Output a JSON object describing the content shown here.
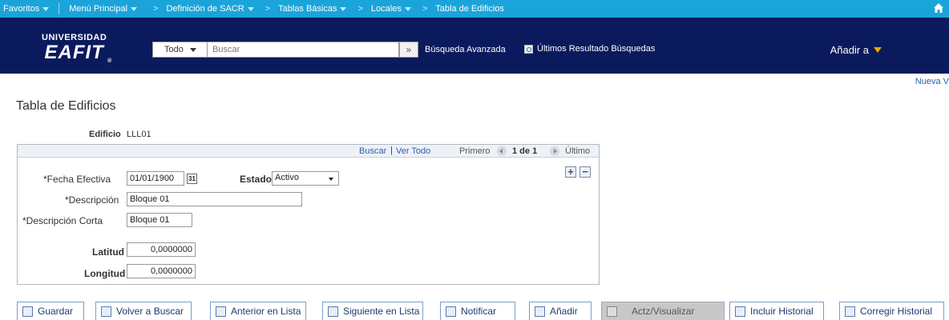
{
  "topnav": {
    "favorites": "Favoritos",
    "main_menu": "Menú Principal",
    "crumbs": [
      "Definición de SACR",
      "Tablas Básicas",
      "Locales",
      "Tabla de Edificios"
    ]
  },
  "header": {
    "logo_line1": "UNIVERSIDAD",
    "logo_line2": "EAFIT",
    "logo_reg": "®",
    "search_scope": "Todo",
    "search_placeholder": "Buscar",
    "search_go": "»",
    "advanced_search": "Búsqueda Avanzada",
    "recent_searches": "Últimos Resultado Búsquedas",
    "add_to": "Añadir a"
  },
  "new_window": "Nueva V",
  "page_title": "Tabla de Edificios",
  "key": {
    "label": "Edificio",
    "value": "LLL01"
  },
  "scroll_head": {
    "search": "Buscar",
    "view_all": "Ver Todo",
    "first": "Primero",
    "position": "1 de 1",
    "last": "Último"
  },
  "form": {
    "effective_date_label": "*Fecha Efectiva",
    "effective_date": "01/01/1900",
    "calendar_glyph": "31",
    "status_label": "Estado",
    "status_value": "Activo",
    "description_label": "*Descripción",
    "description": "Bloque 01",
    "short_description_label": "*Descripción Corta",
    "short_description": "Bloque 01",
    "latitude_label": "Latitud",
    "latitude": "0,0000000",
    "longitude_label": "Longitud",
    "longitude": "0,0000000",
    "add_row": "+",
    "delete_row": "−"
  },
  "buttons": {
    "save": "Guardar",
    "return_to_search": "Volver a Buscar",
    "previous_in_list": "Anterior en Lista",
    "next_in_list": "Siguiente en Lista",
    "notify": "Notificar",
    "add": "Añadir",
    "update_display": "Actz/Visualizar",
    "include_history": "Incluir Historial",
    "correct_history": "Corregir Historial"
  },
  "colors": {
    "topnav": "#1aa4d9",
    "header": "#0a1a5c",
    "accent": "#f0a800",
    "link": "#2a5fb0"
  }
}
